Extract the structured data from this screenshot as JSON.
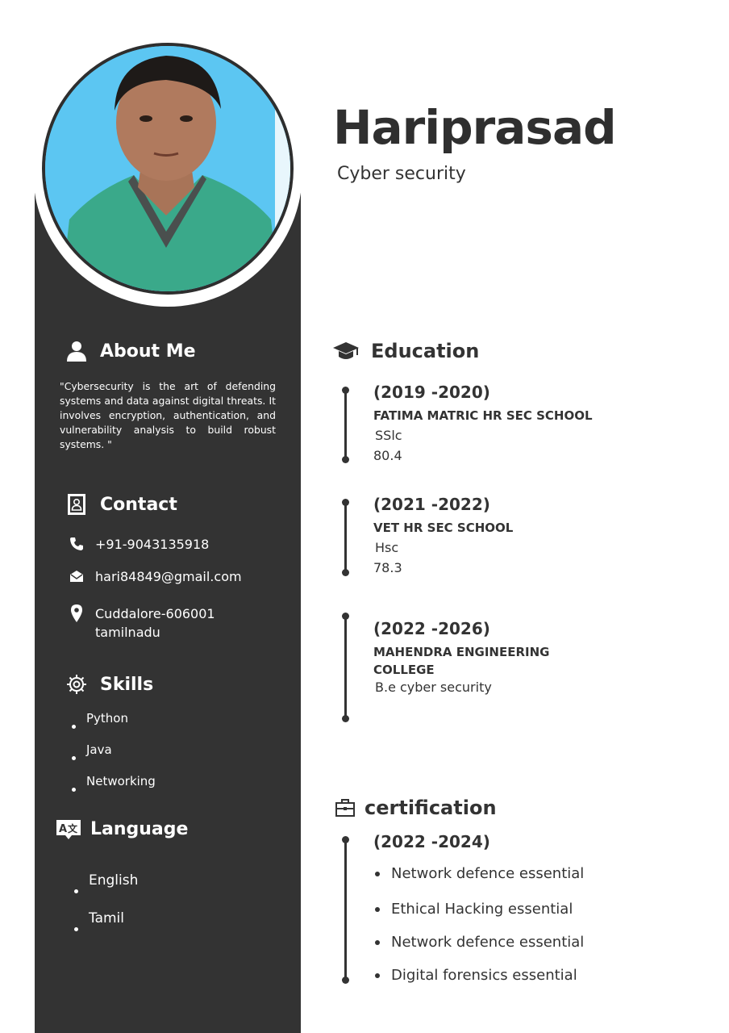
{
  "header": {
    "name": "Hariprasad",
    "role": "Cyber security"
  },
  "about": {
    "title": "About Me",
    "text": "\"Cybersecurity is the art of defending systems and data against digital threats. It involves encryption, authentication, and vulnerability analysis to build robust systems. \""
  },
  "contact": {
    "title": "Contact",
    "phone": "+91-9043135918",
    "email": "hari84849@gmail.com",
    "address_line1": "Cuddalore-606001",
    "address_line2": "tamilnadu"
  },
  "skills": {
    "title": "Skills",
    "items": [
      "Python",
      "Java",
      "Networking"
    ]
  },
  "language": {
    "title": "Language",
    "items": [
      "English",
      "Tamil"
    ]
  },
  "education": {
    "title": "Education",
    "entries": [
      {
        "years": "(2019 -2020)",
        "school": "FATIMA MATRIC HR SEC SCHOOL",
        "degree": "SSlc",
        "score": "80.4"
      },
      {
        "years": "(2021 -2022)",
        "school": "VET HR SEC SCHOOL",
        "degree": "Hsc",
        "score": "78.3"
      },
      {
        "years": "(2022 -2026)",
        "school_line1": "MAHENDRA ENGINEERING",
        "school_line2": "COLLEGE",
        "degree": "B.e cyber security"
      }
    ]
  },
  "certification": {
    "title": "certification",
    "years": "(2022 -2024)",
    "items": [
      "Network defence essential",
      "Ethical Hacking essential",
      "Network defence essential",
      "Digital forensics essential"
    ]
  },
  "icons": {
    "about": "person-icon",
    "contact": "contact-book-icon",
    "phone": "phone-icon",
    "email": "envelope-icon",
    "location": "location-pin-icon",
    "skills": "gear-icon",
    "language": "translate-icon",
    "education": "graduation-cap-icon",
    "certification": "briefcase-icon"
  },
  "colors": {
    "sidebar": "#333333",
    "text_dark": "#333333",
    "text_light": "#ffffff",
    "photo_bg": "#5cc6f2"
  }
}
